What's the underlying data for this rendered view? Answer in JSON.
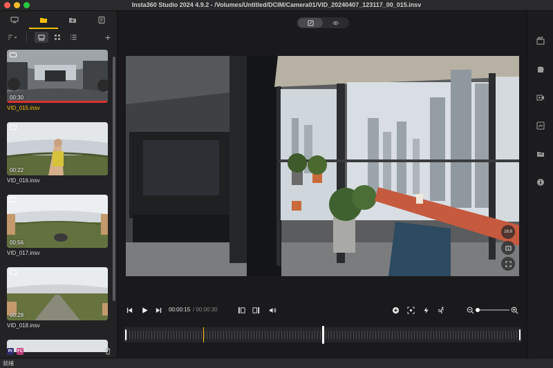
{
  "window": {
    "title": "Insta360 Studio 2024 4.9.2 - /Volumes/Untitled/DCIM/Camera01/VID_20240407_123117_00_015.insv"
  },
  "sidebar": {
    "tabs": [
      {
        "icon": "monitor-icon",
        "active": false
      },
      {
        "icon": "folder-icon",
        "active": true
      },
      {
        "icon": "import-folder-icon",
        "active": false
      },
      {
        "icon": "project-list-icon",
        "active": false
      }
    ],
    "view_tools": [
      {
        "icon": "sort-icon",
        "active": false
      },
      {
        "icon": "large-thumbnail-icon",
        "active": true
      },
      {
        "icon": "grid-view-icon",
        "active": false
      },
      {
        "icon": "list-view-icon",
        "active": false
      }
    ],
    "add_label": "+",
    "files": [
      {
        "name": "VID_015.insv",
        "duration": "00:30",
        "selected": true,
        "scene": "indoor"
      },
      {
        "name": "VID_016.insv",
        "duration": "00:22",
        "selected": false,
        "scene": "field-hand"
      },
      {
        "name": "VID_017.insv",
        "duration": "00:56",
        "selected": false,
        "scene": "field-wide"
      },
      {
        "name": "VID_018.insv",
        "duration": "00:28",
        "selected": false,
        "scene": "field-road"
      }
    ],
    "bottom_chips": [
      {
        "label": "Pr",
        "color": "#2f2a6e"
      },
      {
        "label": "FC",
        "color": "#c0397a"
      }
    ]
  },
  "viewer": {
    "mode_buttons": [
      {
        "icon": "edit-icon",
        "active": true
      },
      {
        "icon": "preview-eye-icon",
        "active": false
      }
    ],
    "aspect_ratio": "16:9"
  },
  "transport": {
    "current_time": "00:00:15",
    "total_time": "/ 00:00:30",
    "zoom_level": 0.0
  },
  "timeline": {
    "playhead_fraction": 0.5,
    "marker_fraction": 0.2
  },
  "status": {
    "text": "就绪"
  },
  "colors": {
    "accent": "#ffc107",
    "selected_bar": "#e03131"
  }
}
